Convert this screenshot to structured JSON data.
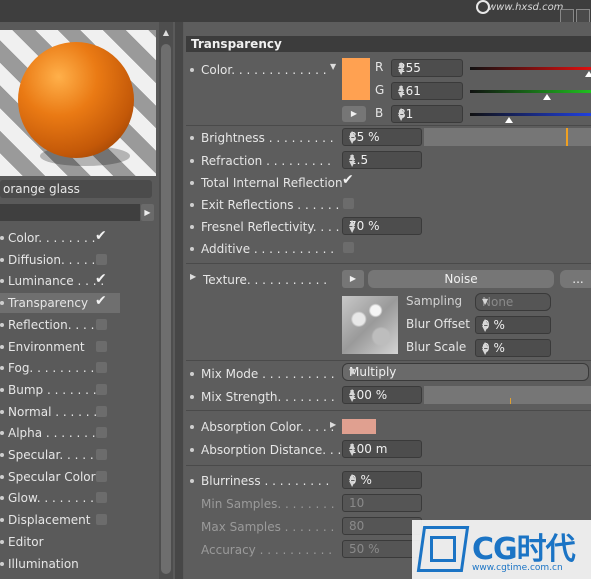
{
  "watermark": {
    "site": "www.hxsd.com"
  },
  "material": {
    "name": "orange glass"
  },
  "channels": [
    {
      "label": "Color. . . . . . . .",
      "checked": true
    },
    {
      "label": "Diffusion. . . . .",
      "checked": false
    },
    {
      "label": "Luminance . . . .",
      "checked": true
    },
    {
      "label": "Transparency",
      "checked": true,
      "selected": true
    },
    {
      "label": "Reflection. . . .",
      "checked": false
    },
    {
      "label": "Environment",
      "checked": false
    },
    {
      "label": "Fog. . . . . . . . .",
      "checked": false
    },
    {
      "label": "Bump . . . . . . .",
      "checked": false
    },
    {
      "label": "Normal . . . . . .",
      "checked": false
    },
    {
      "label": "Alpha . . . . . . .",
      "checked": false
    },
    {
      "label": "Specular. . . . .",
      "checked": false
    },
    {
      "label": "Specular Color",
      "checked": false
    },
    {
      "label": "Glow. . . . . . . .",
      "checked": false
    },
    {
      "label": "Displacement",
      "checked": false
    },
    {
      "label": "Editor",
      "checked": null
    },
    {
      "label": "Illumination",
      "checked": null
    }
  ],
  "panel": {
    "title": "Transparency",
    "color": {
      "label": "Color. . . . . . . . . . . . .",
      "hex": "#FFA151",
      "r_label": "R",
      "r": "255",
      "g_label": "G",
      "g": "161",
      "b_label": "B",
      "b": "81"
    },
    "brightness": {
      "label": "Brightness . . . . . . . . .",
      "value": "85 %",
      "fraction": 0.85
    },
    "refraction": {
      "label": "Refraction . . . . . . . . .",
      "value": "1.5"
    },
    "total_internal_reflection": {
      "label": "Total Internal Reflection",
      "checked": true
    },
    "exit_reflections": {
      "label": "Exit Reflections . . . . . .",
      "checked": false
    },
    "fresnel": {
      "label": "Fresnel Reflectivity. . . .",
      "value": "70 %"
    },
    "additive": {
      "label": "Additive . . . . . . . . . . .",
      "checked": false
    },
    "texture": {
      "label": "Texture. . . . . . . . . . .",
      "shader_label": "Noise",
      "more_label": "...",
      "sampling_label": "Sampling",
      "sampling_value": "None",
      "blur_offset_label": "Blur Offset",
      "blur_offset_value": "0 %",
      "blur_scale_label": "Blur Scale",
      "blur_scale_value": "0 %"
    },
    "mix_mode": {
      "label": "Mix Mode . . . . . . . . . .",
      "value": "Multiply"
    },
    "mix_strength": {
      "label": "Mix Strength. . . . . . . .",
      "value": "100 %"
    },
    "absorption_color": {
      "label": "Absorption Color. . . . .",
      "hex": "#E0A090"
    },
    "absorption_distance": {
      "label": "Absorption Distance. . .",
      "value": "100 m"
    },
    "blurriness": {
      "label": "Blurriness . . . . . . . . .",
      "value": "0 %"
    },
    "min_samples": {
      "label": "Min Samples. . . . . . . .",
      "value": "10"
    },
    "max_samples": {
      "label": "Max Samples . . . . . . .",
      "value": "80"
    },
    "accuracy": {
      "label": "Accuracy . . . . . . . . . .",
      "value": "50 %"
    }
  },
  "logo": {
    "text": "CG时代",
    "url": "www.cgtime.com.cn"
  },
  "colors": {
    "accent_orange": "#F0A020",
    "red_bar": "#E01010",
    "green_bar": "#20C020",
    "blue_bar": "#2040E0"
  }
}
